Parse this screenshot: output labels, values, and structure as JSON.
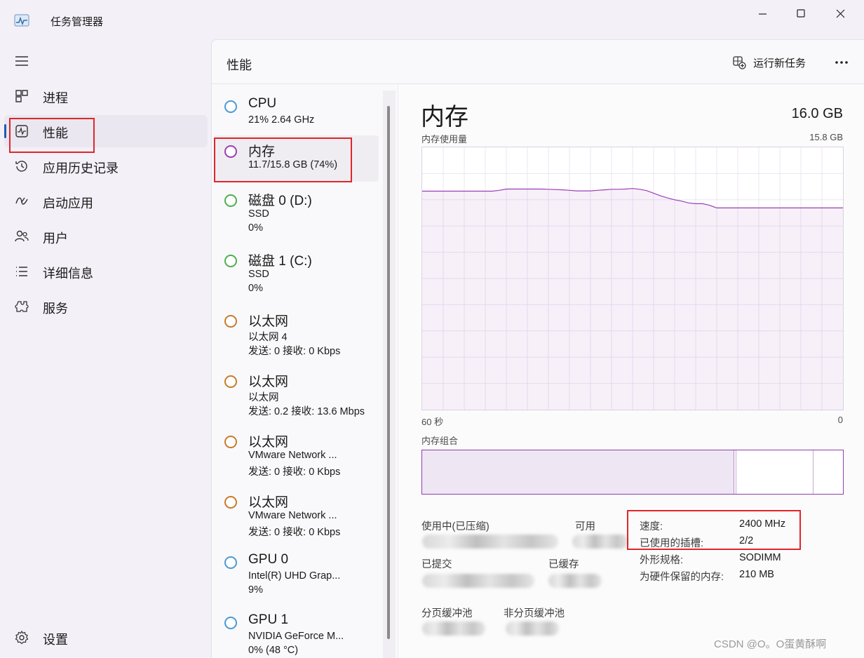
{
  "window": {
    "title": "任务管理器"
  },
  "nav": {
    "items": [
      {
        "label": "进程",
        "icon": "processes-icon"
      },
      {
        "label": "性能",
        "icon": "performance-icon",
        "active": true
      },
      {
        "label": "应用历史记录",
        "icon": "history-icon"
      },
      {
        "label": "启动应用",
        "icon": "startup-icon"
      },
      {
        "label": "用户",
        "icon": "users-icon"
      },
      {
        "label": "详细信息",
        "icon": "details-icon"
      },
      {
        "label": "服务",
        "icon": "services-icon"
      }
    ],
    "settings_label": "设置"
  },
  "header": {
    "title": "性能",
    "run_task_label": "运行新任务"
  },
  "resources": [
    {
      "name": "CPU",
      "lines": [
        "21% 2.64 GHz"
      ],
      "color": "#4a9ad4"
    },
    {
      "name": "内存",
      "lines": [
        "11.7/15.8 GB (74%)"
      ],
      "color": "#9b3fb5",
      "selected": true
    },
    {
      "name": "磁盘 0 (D:)",
      "lines": [
        "SSD",
        "0%"
      ],
      "color": "#4caf50"
    },
    {
      "name": "磁盘 1 (C:)",
      "lines": [
        "SSD",
        "0%"
      ],
      "color": "#4caf50"
    },
    {
      "name": "以太网",
      "lines": [
        "以太网 4",
        "发送: 0 接收: 0 Kbps"
      ],
      "color": "#c97a2c"
    },
    {
      "name": "以太网",
      "lines": [
        "以太网",
        "发送: 0.2 接收: 13.6 Mbps"
      ],
      "color": "#c97a2c"
    },
    {
      "name": "以太网",
      "lines": [
        "VMware Network ...",
        "发送: 0 接收: 0 Kbps"
      ],
      "color": "#c97a2c"
    },
    {
      "name": "以太网",
      "lines": [
        "VMware Network ...",
        "发送: 0 接收: 0 Kbps"
      ],
      "color": "#c97a2c"
    },
    {
      "name": "GPU 0",
      "lines": [
        "Intel(R) UHD Grap...",
        "9%"
      ],
      "color": "#4a9ad4"
    },
    {
      "name": "GPU 1",
      "lines": [
        "NVIDIA GeForce M...",
        "0% (48 °C)"
      ],
      "color": "#4a9ad4"
    }
  ],
  "detail": {
    "title": "内存",
    "total": "16.0 GB",
    "graph_label": "内存使用量",
    "graph_max": "15.8 GB",
    "time_left": "60 秒",
    "time_right": "0",
    "composition_label": "内存组合",
    "usage_series_pct": [
      83.3,
      83.3,
      83.3,
      83.3,
      83.3,
      83.3,
      83.3,
      83.3,
      83.3,
      83.3,
      83.3,
      83.6,
      84.1,
      84.1,
      84.1,
      84.1,
      84.1,
      84.1,
      84.0,
      83.9,
      83.8,
      83.6,
      83.4,
      83.4,
      83.4,
      83.6,
      83.8,
      84.0,
      84.0,
      84.1,
      84.3,
      84.0,
      83.5,
      82.5,
      81.5,
      80.7,
      80.0,
      79.5,
      78.8,
      78.5,
      78.5,
      77.9,
      76.9,
      76.9,
      76.9,
      76.9,
      76.9,
      76.9,
      76.9,
      76.9,
      76.9,
      76.9,
      76.9,
      76.9,
      76.9,
      76.9,
      76.9,
      76.9,
      76.9,
      76.9,
      76.9
    ]
  },
  "stats": {
    "in_use_label": "使用中(已压缩)",
    "available_label": "可用",
    "committed_label": "已提交",
    "cached_label": "已缓存",
    "paged_pool_label": "分页缓冲池",
    "nonpaged_pool_label": "非分页缓冲池"
  },
  "specs": [
    {
      "label": "速度:",
      "value": "2400 MHz"
    },
    {
      "label": "已使用的插槽:",
      "value": "2/2"
    },
    {
      "label": "外形规格:",
      "value": "SODIMM"
    },
    {
      "label": "为硬件保留的内存:",
      "value": "210 MB"
    }
  ],
  "watermark": "CSDN @O。O蛋黄酥啊",
  "colors": {
    "memory": "#9b3fb5",
    "highlight": "#e0262a",
    "accent": "#1a5fb4"
  }
}
